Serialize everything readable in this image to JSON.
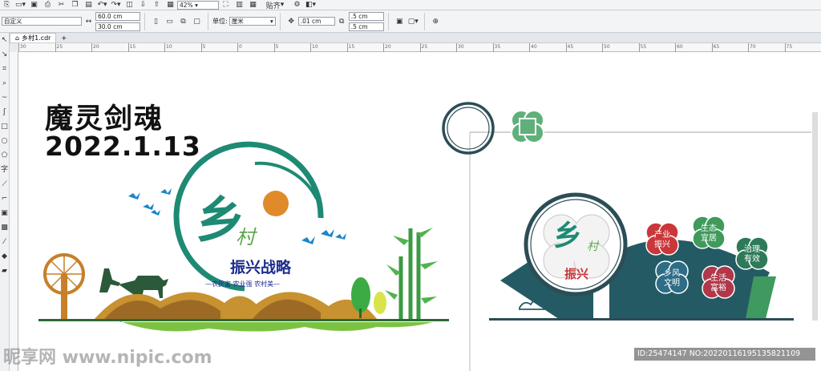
{
  "toolbar_top": {
    "zoom": "42%",
    "snap_label": "贴齐"
  },
  "property_bar": {
    "preset": "自定义",
    "width": "60.0 cm",
    "height": "30.0 cm",
    "unit_label": "单位:",
    "unit_value": "厘米",
    "nudge": ".01 cm",
    "dup_x": ".5 cm",
    "dup_y": ".5 cm"
  },
  "tab": {
    "filename": "乡村1.cdr"
  },
  "ruler": {
    "ticks": [
      "30",
      "25",
      "20",
      "15",
      "10",
      "5",
      "0",
      "5",
      "10",
      "15",
      "20",
      "25",
      "30",
      "35",
      "40",
      "45",
      "50",
      "55",
      "60",
      "65",
      "70",
      "75"
    ]
  },
  "canvas": {
    "title": "魔灵剑魂",
    "date": "2022.1.13"
  },
  "design_left": {
    "logo_char1": "乡",
    "logo_char2": "村",
    "slogan_main": "振兴战略",
    "slogan_sub": "—农民富 农业强 农村美—"
  },
  "design_right": {
    "logo_char1": "乡",
    "logo_char2": "村",
    "slogan": "振兴",
    "badges": [
      {
        "text1": "产业",
        "text2": "振兴",
        "color": "#c9373a"
      },
      {
        "text1": "生态",
        "text2": "宜居",
        "color": "#3f9a5c"
      },
      {
        "text1": "治理",
        "text2": "有效",
        "color": "#2d7a58"
      },
      {
        "text1": "乡风",
        "text2": "文明",
        "color": "#2e6d86"
      },
      {
        "text1": "生活",
        "text2": "富裕",
        "color": "#b1384a"
      }
    ]
  },
  "watermark": {
    "site": "昵享网 www.nipic.com",
    "id_text": "ID:25474147 NO:20220116195135821109"
  },
  "colors": {
    "teal": "#1e8a74",
    "dark_teal": "#245a64",
    "green": "#6fbe44",
    "blue_bird": "#1a86c8",
    "orange_sun": "#e08a2a",
    "navy_text": "#1c2c8e"
  }
}
